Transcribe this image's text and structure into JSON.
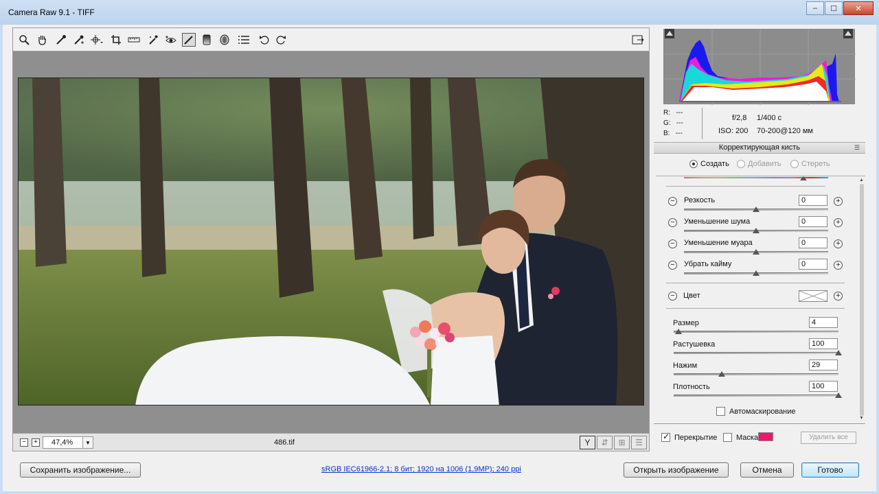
{
  "window": {
    "title": "Camera Raw 9.1  -  TIFF",
    "min_label": "–",
    "max_label": "☐",
    "close_label": "✕"
  },
  "toolbar": {
    "tools": [
      "zoom-icon",
      "hand-icon",
      "white-balance-icon",
      "color-sampler-icon",
      "targeted-adjustment-icon",
      "crop-icon",
      "straighten-icon",
      "spot-removal-icon",
      "red-eye-icon",
      "adjustment-brush-icon",
      "graduated-filter-icon",
      "radial-filter-icon",
      "preferences-icon",
      "rotate-left-icon",
      "rotate-right-icon"
    ],
    "fullscreen_icon": "fullscreen-icon"
  },
  "bottom": {
    "zoom_minus": "−",
    "zoom_plus": "+",
    "zoom_value": "47,4%",
    "filename": "486.tif",
    "view_buttons": [
      "Y",
      "⇵",
      "⊞",
      "☰"
    ]
  },
  "histogram": {
    "rgb_labels": [
      "R:",
      "G:",
      "B:"
    ],
    "rgb_values": [
      "---",
      "---",
      "---"
    ],
    "aperture": "f/2,8",
    "shutter": "1/400 с",
    "iso": "ISO: 200",
    "lens": "70-200@120 мм"
  },
  "panel": {
    "title": "Корректирующая кисть",
    "modes": [
      {
        "label": "Создать",
        "selected": true,
        "enabled": true
      },
      {
        "label": "Добавить",
        "selected": false,
        "enabled": false
      },
      {
        "label": "Стереть",
        "selected": false,
        "enabled": false
      }
    ],
    "effects": [
      {
        "label": "Резкость",
        "value": "0",
        "level": 0.5
      },
      {
        "label": "Уменьшение шума",
        "value": "0",
        "level": 0.5
      },
      {
        "label": "Уменьшение муара",
        "value": "0",
        "level": 0.5
      },
      {
        "label": "Убрать кайму",
        "value": "0",
        "level": 0.5
      }
    ],
    "color_label": "Цвет",
    "brush": [
      {
        "label": "Размер",
        "value": "4",
        "level": 0.03
      },
      {
        "label": "Растушевка",
        "value": "100",
        "level": 1.0
      },
      {
        "label": "Нажим",
        "value": "29",
        "level": 0.29
      },
      {
        "label": "Плотность",
        "value": "100",
        "level": 1.0
      }
    ],
    "automask_label": "Автомаскирование",
    "overlay_label": "Перекрытие",
    "mask_label": "Маска",
    "mask_color": "#e8196e",
    "clear_all_label": "Удалить все"
  },
  "footer": {
    "save_label": "Сохранить изображение...",
    "info_link": "sRGB IEC61966-2.1; 8 бит; 1920 на 1006 (1,9MP); 240 ppi",
    "open_label": "Открыть изображение",
    "cancel_label": "Отмена",
    "done_label": "Готово"
  }
}
